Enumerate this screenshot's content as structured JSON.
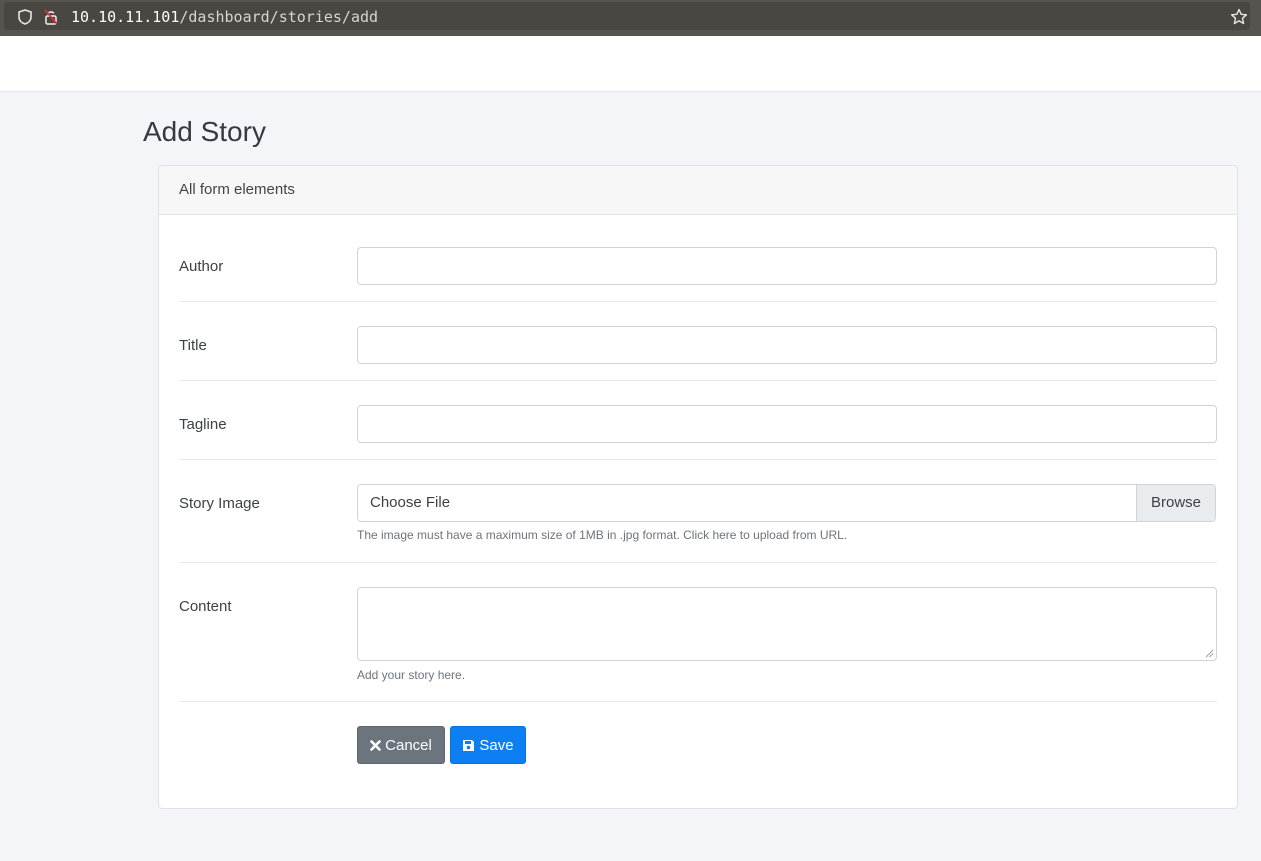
{
  "browser": {
    "url_host": "10.10.11.101",
    "url_path": "/dashboard/stories/add"
  },
  "page": {
    "title": "Add Story"
  },
  "card": {
    "header": "All form elements"
  },
  "form": {
    "author_label": "Author",
    "author_value": "",
    "title_label": "Title",
    "title_value": "",
    "tagline_label": "Tagline",
    "tagline_value": "",
    "image_label": "Story Image",
    "image_choose": "Choose File",
    "image_browse": "Browse",
    "image_help": "The image must have a maximum size of 1MB in .jpg format. Click here to upload from URL.",
    "content_label": "Content",
    "content_value": "",
    "content_help": "Add your story here."
  },
  "actions": {
    "cancel_label": "Cancel",
    "save_label": "Save"
  },
  "colors": {
    "cancel": "#6c757d",
    "save": "#0d7ff2",
    "background": "#f4f5f8"
  },
  "icons": [
    "shield-icon",
    "insecure-lock-icon",
    "bookmark-star-icon",
    "close-icon",
    "floppy-disk-icon",
    "resize-grip-icon"
  ]
}
